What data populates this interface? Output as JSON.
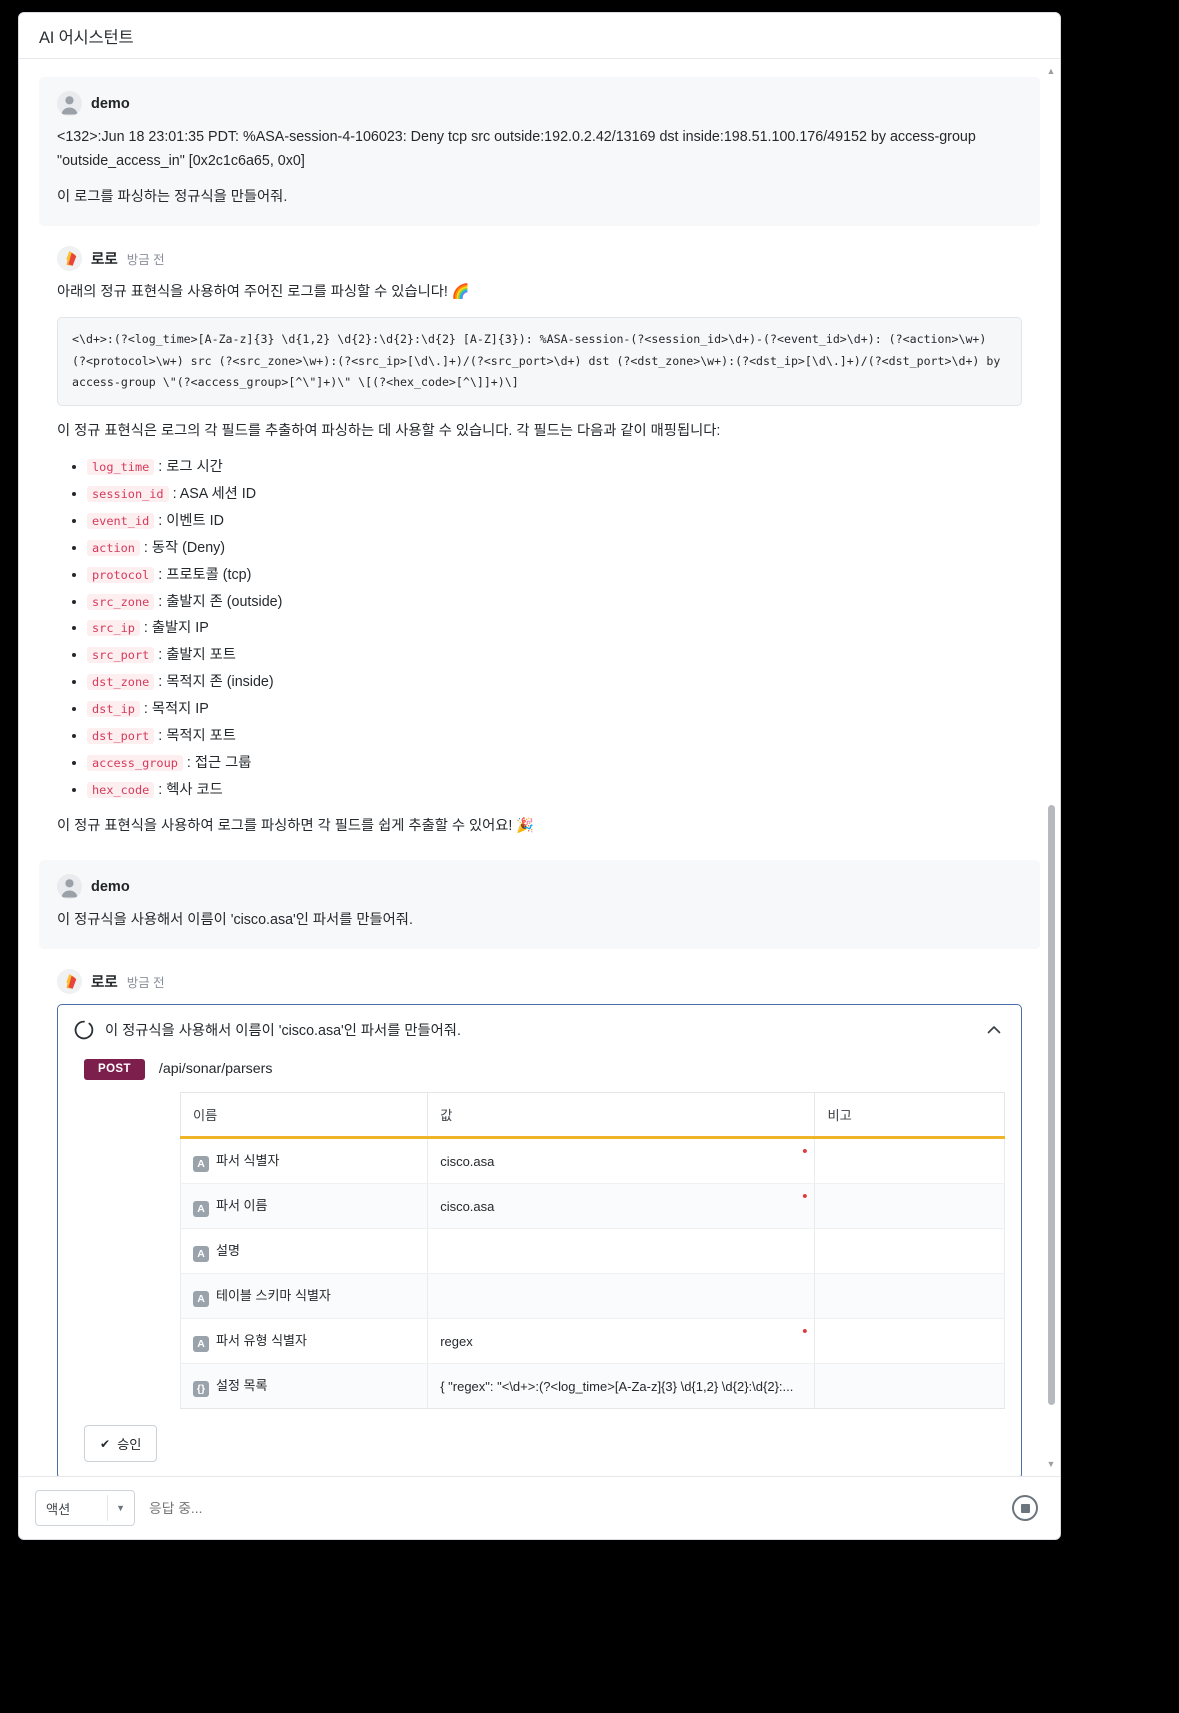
{
  "window": {
    "title": "AI 어시스턴트"
  },
  "colors": {
    "accent_border": "#4a6ea8",
    "method_badge": "#7c1f4d",
    "table_header_underline": "#f0b429",
    "required_dot": "#e03b3b",
    "inline_code_text": "#d63a5b",
    "inline_code_bg": "#fdeef0"
  },
  "messages": [
    {
      "role": "user",
      "author": "demo",
      "avatar_icon": "user-avatar-icon",
      "log_text": "<132>:Jun 18 23:01:35 PDT: %ASA-session-4-106023: Deny tcp src outside:192.0.2.42/13169 dst inside:198.51.100.176/49152 by access-group \"outside_access_in\" [0x2c1c6a65, 0x0]",
      "request_text": "이 로그를 파싱하는 정규식을 만들어줘."
    },
    {
      "role": "assistant",
      "author": "로로",
      "timestamp": "방금 전",
      "avatar_icon": "loro-gem-icon",
      "intro_text": "아래의 정규 표현식을 사용하여 주어진 로그를 파싱할 수 있습니다! 🌈",
      "code": "<\\d+>:(?<log_time>[A-Za-z]{3} \\d{1,2} \\d{2}:\\d{2}:\\d{2} [A-Z]{3}): %ASA-session-(?<session_id>\\d+)-(?<event_id>\\d+): (?<action>\\w+) (?<protocol>\\w+) src (?<src_zone>\\w+):(?<src_ip>[\\d\\.]+)/(?<src_port>\\d+) dst (?<dst_zone>\\w+):(?<dst_ip>[\\d\\.]+)/(?<dst_port>\\d+) by access-group \\\"(?<access_group>[^\\\"]+)\\\" \\[(?<hex_code>[^\\]]+)\\]",
      "explain_text": "이 정규 표현식은 로그의 각 필드를 추출하여 파싱하는 데 사용할 수 있습니다. 각 필드는 다음과 같이 매핑됩니다:",
      "fields": [
        {
          "name": "log_time",
          "desc": "로그 시간"
        },
        {
          "name": "session_id",
          "desc": "ASA 세션 ID"
        },
        {
          "name": "event_id",
          "desc": "이벤트 ID"
        },
        {
          "name": "action",
          "desc": "동작 (Deny)"
        },
        {
          "name": "protocol",
          "desc": "프로토콜 (tcp)"
        },
        {
          "name": "src_zone",
          "desc": "출발지 존 (outside)"
        },
        {
          "name": "src_ip",
          "desc": "출발지 IP"
        },
        {
          "name": "src_port",
          "desc": "출발지 포트"
        },
        {
          "name": "dst_zone",
          "desc": "목적지 존 (inside)"
        },
        {
          "name": "dst_ip",
          "desc": "목적지 IP"
        },
        {
          "name": "dst_port",
          "desc": "목적지 포트"
        },
        {
          "name": "access_group",
          "desc": "접근 그룹"
        },
        {
          "name": "hex_code",
          "desc": "헥사 코드"
        }
      ],
      "outro_text": "이 정규 표현식을 사용하여 로그를 파싱하면 각 필드를 쉽게 추출할 수 있어요! 🎉"
    },
    {
      "role": "user",
      "author": "demo",
      "avatar_icon": "user-avatar-icon",
      "request_text": "이 정규식을 사용해서 이름이 'cisco.asa'인 파서를 만들어줘."
    },
    {
      "role": "assistant",
      "author": "로로",
      "timestamp": "방금 전",
      "avatar_icon": "loro-gem-icon"
    }
  ],
  "tool_card": {
    "spinner_icon": "loading-spinner-icon",
    "title": "이 정규식을 사용해서 이름이 'cisco.asa'인 파서를 만들어줘.",
    "collapse_icon": "chevron-up-icon",
    "method": "POST",
    "endpoint": "/api/sonar/parsers",
    "table": {
      "headers": [
        "이름",
        "값",
        "비고"
      ],
      "rows": [
        {
          "type": "A",
          "name": "파서 식별자",
          "value": "cisco.asa",
          "required": true,
          "note": ""
        },
        {
          "type": "A",
          "name": "파서 이름",
          "value": "cisco.asa",
          "required": true,
          "note": ""
        },
        {
          "type": "A",
          "name": "설명",
          "value": "",
          "required": false,
          "note": ""
        },
        {
          "type": "A",
          "name": "테이블 스키마 식별자",
          "value": "",
          "required": false,
          "note": ""
        },
        {
          "type": "A",
          "name": "파서 유형 식별자",
          "value": "regex",
          "required": true,
          "note": ""
        },
        {
          "type": "{}",
          "name": "설정 목록",
          "value": "{ \"regex\": \"<\\d+>:(?<log_time>[A-Za-z]{3} \\d{1,2} \\d{2}:\\d{2}:...",
          "required": false,
          "note": ""
        }
      ]
    },
    "approve_label": "승인",
    "approve_icon": "check-icon"
  },
  "composer": {
    "action_label": "액션",
    "action_caret_icon": "chevron-down-icon",
    "input_placeholder": "응답 중...",
    "input_value": "",
    "stop_button_icon": "stop-recording-icon"
  },
  "scrollbar": {
    "up_icon": "triangle-up-icon",
    "down_icon": "triangle-down-icon"
  }
}
